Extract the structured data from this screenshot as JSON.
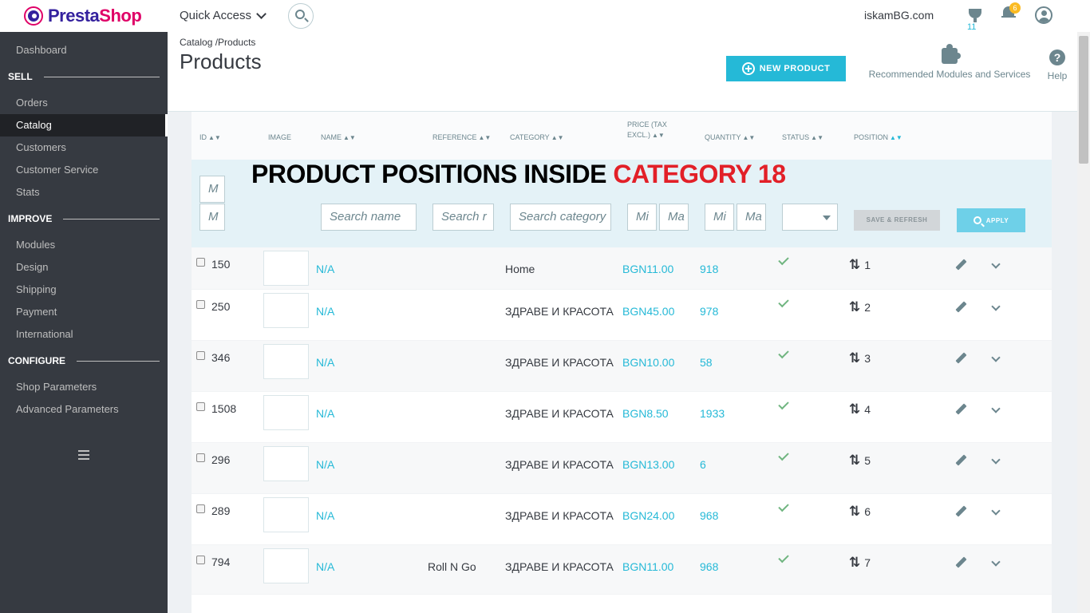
{
  "header": {
    "logo_part1": "Presta",
    "logo_part2": "Shop",
    "quick_access": "Quick Access",
    "shop_name": "iskamBG.com",
    "trophy_count": "11",
    "notification_count": "6"
  },
  "sidebar": {
    "dashboard": "Dashboard",
    "sections": [
      {
        "title": "SELL",
        "items": [
          "Orders",
          "Catalog",
          "Customers",
          "Customer Service",
          "Stats"
        ]
      },
      {
        "title": "IMPROVE",
        "items": [
          "Modules",
          "Design",
          "Shipping",
          "Payment",
          "International"
        ]
      },
      {
        "title": "CONFIGURE",
        "items": [
          "Shop Parameters",
          "Advanced Parameters"
        ]
      }
    ],
    "active_item": "Catalog"
  },
  "page": {
    "breadcrumb_parent": "Catalog",
    "breadcrumb_sep": " /",
    "breadcrumb_current": "Products",
    "title": "Products",
    "new_product_label": "NEW PRODUCT",
    "recommended_label": "Recommended Modules and Services",
    "help_label": "Help"
  },
  "table": {
    "columns": {
      "id": "ID",
      "image": "IMAGE",
      "name": "NAME",
      "reference": "REFERENCE",
      "category": "CATEGORY",
      "price_line1": "PRICE (TAX",
      "price_line2": "EXCL.)",
      "quantity": "QUANTITY",
      "status": "STATUS",
      "position": "POSITION"
    },
    "sort_glyph": "▲▼",
    "filters": {
      "id_min_placeholder": "M",
      "id_max_placeholder": "M",
      "name_placeholder": "Search name",
      "reference_placeholder": "Search r",
      "category_placeholder": "Search category",
      "price_min_placeholder": "Mi",
      "price_max_placeholder": "Ma",
      "qty_min_placeholder": "Mi",
      "qty_max_placeholder": "Ma",
      "save_refresh_label": "SAVE & REFRESH",
      "apply_label": "APPLY"
    },
    "overlay_banner_black": "PRODUCT POSITIONS INSIDE ",
    "overlay_banner_red": "CATEGORY 18",
    "rows": [
      {
        "id": "150",
        "name": "N/A",
        "reference": "",
        "category": "Home",
        "price": "BGN11.00",
        "quantity": "918",
        "position": "1"
      },
      {
        "id": "250",
        "name": "N/A",
        "reference": "",
        "category": "ЗДРАВЕ И КРАСОТА",
        "price": "BGN45.00",
        "quantity": "978",
        "position": "2"
      },
      {
        "id": "346",
        "name": "N/A",
        "reference": "",
        "category": "ЗДРАВЕ И КРАСОТА",
        "price": "BGN10.00",
        "quantity": "58",
        "position": "3"
      },
      {
        "id": "1508",
        "name": "N/A",
        "reference": "",
        "category": "ЗДРАВЕ И КРАСОТА",
        "price": "BGN8.50",
        "quantity": "1933",
        "position": "4"
      },
      {
        "id": "296",
        "name": "N/A",
        "reference": "",
        "category": "ЗДРАВЕ И КРАСОТА",
        "price": "BGN13.00",
        "quantity": "6",
        "position": "5"
      },
      {
        "id": "289",
        "name": "N/A",
        "reference": "",
        "category": "ЗДРАВЕ И КРАСОТА",
        "price": "BGN24.00",
        "quantity": "968",
        "position": "6"
      },
      {
        "id": "794",
        "name": "N/A",
        "reference": "Roll N Go",
        "category": "ЗДРАВЕ И КРАСОТА",
        "price": "BGN11.00",
        "quantity": "968",
        "position": "7"
      }
    ]
  },
  "icons": {
    "logo": "prestashop-logo-icon",
    "search": "search-icon",
    "trophy": "trophy-icon",
    "bell": "bell-icon",
    "user": "user-icon",
    "puzzle": "puzzle-icon",
    "help": "help-icon",
    "edit": "pencil-icon",
    "status": "check-icon",
    "position": "sort-arrows-icon"
  },
  "colors": {
    "accent": "#25b9d7",
    "sidebar": "#363a41",
    "brand_purple": "#34219e",
    "brand_pink": "#df0067",
    "banner_red": "#e22028",
    "status_green": "#70b580"
  }
}
